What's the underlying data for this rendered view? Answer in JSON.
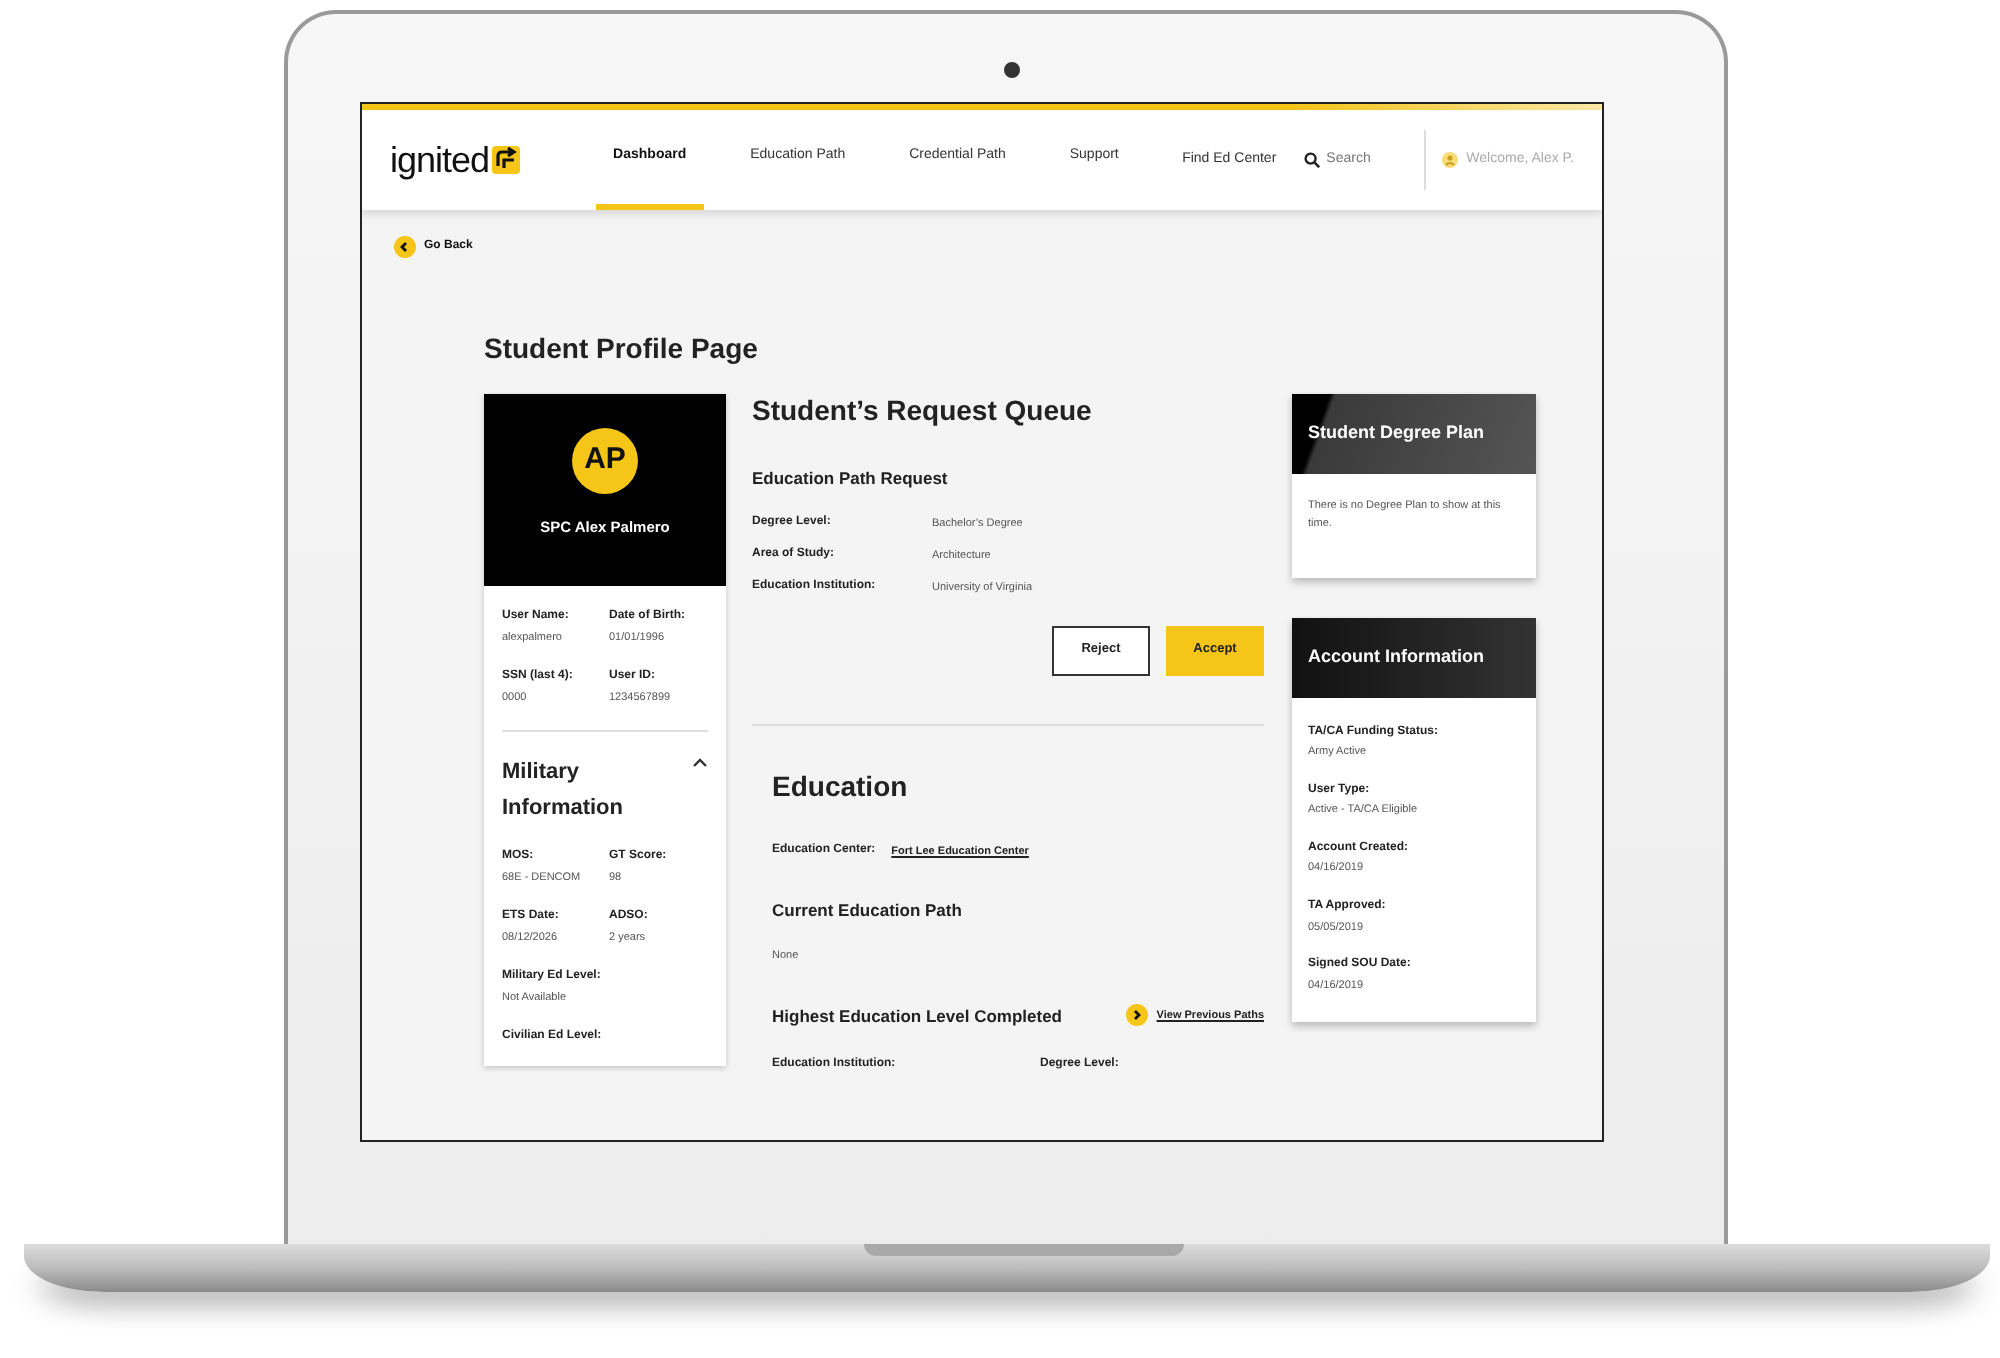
{
  "nav": {
    "logo": "ignited",
    "items": [
      {
        "label": "Dashboard",
        "selected": true
      },
      {
        "label": "Education Path",
        "selected": false
      },
      {
        "label": "Credential Path",
        "selected": false
      },
      {
        "label": "Support",
        "selected": false
      }
    ],
    "find": "Find Ed Center",
    "search": {
      "placeholder": "Search"
    },
    "welcome": "Welcome, Alex P."
  },
  "go_back": "Go Back",
  "page_title": "Student Profile Page",
  "profile": {
    "initials": "AP",
    "name": "SPC Alex Palmero",
    "fields": [
      {
        "label": "User Name:",
        "value": "alexpalmero"
      },
      {
        "label": "Date of Birth:",
        "value": "01/01/1996"
      },
      {
        "label": "SSN (last 4):",
        "value": "0000"
      },
      {
        "label": "User ID:",
        "value": "1234567899"
      }
    ],
    "military": {
      "title": "Military Information",
      "expanded": true,
      "fields": [
        {
          "label": "MOS:",
          "value": "68E - DENCOM"
        },
        {
          "label": "GT Score:",
          "value": "98"
        },
        {
          "label": "ETS Date:",
          "value": "08/12/2026"
        },
        {
          "label": "ADSO:",
          "value": "2 years"
        },
        {
          "label": "Military Ed Level:",
          "value": "Not Available",
          "wide": true
        },
        {
          "label": "Civilian Ed Level:",
          "wide": true
        }
      ]
    }
  },
  "request_queue": {
    "title": "Student’s Request Queue",
    "subtitle": "Education Path Request",
    "rows": [
      {
        "label": "Degree Level:",
        "value": "Bachelor’s Degree"
      },
      {
        "label": "Area of Study:",
        "value": "Architecture"
      },
      {
        "label": "Education Institution:",
        "value": "University of Virginia"
      }
    ],
    "buttons": [
      {
        "label": "Reject",
        "kind": "outline"
      },
      {
        "label": "Accept",
        "kind": "primary"
      }
    ]
  },
  "education": {
    "title": "Education",
    "center_label": "Education Center:",
    "center_link": "Fort Lee Education Center",
    "current_title": "Current Education Path",
    "current_value": "None",
    "highest_title": "Highest Education Level Completed",
    "view_link": "View Previous Paths",
    "columns": [
      "Education Institution:",
      "Degree Level:"
    ]
  },
  "degree_plan": {
    "title": "Student Degree Plan",
    "message": "There is no Degree Plan to show at this time."
  },
  "account": {
    "title": "Account Information",
    "fields": [
      {
        "label": "TA/CA Funding Status:",
        "value": "Army Active"
      },
      {
        "label": "User Type:",
        "value": "Active - TA/CA Eligible"
      },
      {
        "label": "Account Created:",
        "value": "04/16/2019"
      },
      {
        "label": "TA Approved:",
        "value": "05/05/2019"
      },
      {
        "label": "Signed SOU Date:",
        "value": "04/16/2019"
      }
    ]
  }
}
